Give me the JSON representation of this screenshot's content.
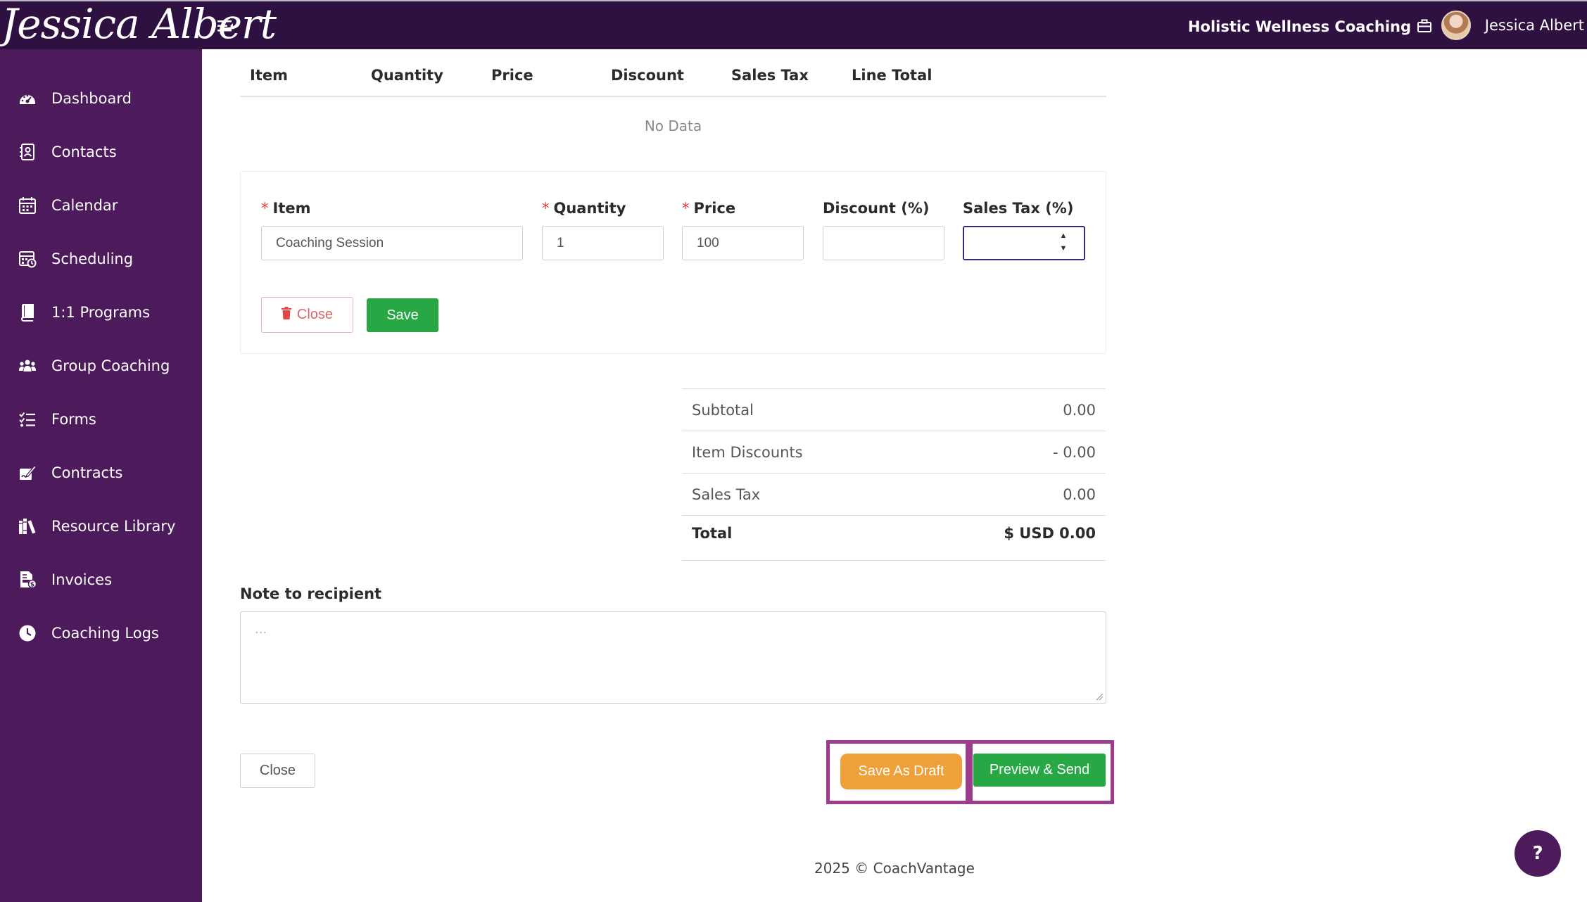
{
  "header": {
    "logo_text": "Jessica Albert",
    "org_name": "Holistic Wellness Coaching",
    "user_name": "Jessica Albert"
  },
  "sidebar": {
    "items": [
      {
        "label": "Dashboard",
        "icon": "dashboard-icon"
      },
      {
        "label": "Contacts",
        "icon": "contacts-icon"
      },
      {
        "label": "Calendar",
        "icon": "calendar-icon"
      },
      {
        "label": "Scheduling",
        "icon": "scheduling-icon"
      },
      {
        "label": "1:1 Programs",
        "icon": "book-icon"
      },
      {
        "label": "Group Coaching",
        "icon": "group-icon"
      },
      {
        "label": "Forms",
        "icon": "forms-icon"
      },
      {
        "label": "Contracts",
        "icon": "contract-icon"
      },
      {
        "label": "Resource Library",
        "icon": "library-icon"
      },
      {
        "label": "Invoices",
        "icon": "invoice-icon"
      },
      {
        "label": "Coaching Logs",
        "icon": "clock-icon"
      }
    ]
  },
  "table": {
    "columns": [
      "Item",
      "Quantity",
      "Price",
      "Discount",
      "Sales Tax",
      "Line Total"
    ],
    "empty_text": "No Data"
  },
  "line_form": {
    "item_label": "Item",
    "item_value": "Coaching Session",
    "quantity_label": "Quantity",
    "quantity_value": "1",
    "price_label": "Price",
    "price_value": "100",
    "discount_label": "Discount (%)",
    "discount_value": "",
    "tax_label": "Sales Tax (%)",
    "tax_value": "",
    "required_mark": "*",
    "close_label": "Close",
    "save_label": "Save"
  },
  "summary": {
    "subtotal_label": "Subtotal",
    "subtotal_value": "0.00",
    "discounts_label": "Item Discounts",
    "discounts_value": "- 0.00",
    "tax_label": "Sales Tax",
    "tax_value": "0.00",
    "total_label": "Total",
    "total_value": "$ USD 0.00"
  },
  "note": {
    "label": "Note to recipient",
    "placeholder": "..."
  },
  "actions": {
    "close_label": "Close",
    "draft_label": "Save As Draft",
    "preview_label": "Preview & Send"
  },
  "colors": {
    "topbar": "#2e1140",
    "sidebar": "#4d1a5c",
    "primary_green": "#28a745",
    "draft_orange": "#f0a03a",
    "highlight": "#9b3d8c"
  },
  "footer": {
    "text": "2025 © CoachVantage"
  },
  "help": {
    "label": "?"
  }
}
